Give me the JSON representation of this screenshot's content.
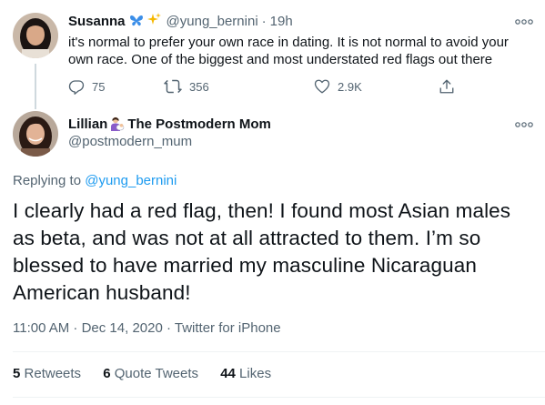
{
  "parent_tweet": {
    "author_name": "Susanna",
    "name_emojis": [
      "butterfly",
      "sparkles"
    ],
    "handle": "@yung_bernini",
    "separator": "·",
    "time": "19h",
    "text": "it's normal to prefer your own race in dating. It is not normal to avoid your own race. One of the biggest and most understated red flags out there",
    "actions": {
      "replies": "75",
      "retweets": "356",
      "likes": "2.9K"
    }
  },
  "main_tweet": {
    "author_name": "Lillian",
    "name_emoji": "woman-feeding-baby",
    "name_suffix": "The Postmodern Mom",
    "handle": "@postmodern_mum",
    "replying_prefix": "Replying to",
    "replying_to": "@yung_bernini",
    "text": "I clearly had a red flag, then! I found most Asian males as beta, and was not at all attracted to them. I’m so blessed to have married my masculine Nicaraguan American husband!",
    "timestamp": "11:00 AM · Dec 14, 2020 · Twitter for iPhone",
    "stats": {
      "retweets_count": "5",
      "retweets_label": "Retweets",
      "quotes_count": "6",
      "quotes_label": "Quote Tweets",
      "likes_count": "44",
      "likes_label": "Likes"
    }
  },
  "colors": {
    "text": "#0f1419",
    "secondary": "#536471",
    "link": "#1d9bf0",
    "divider": "#eff3f4"
  }
}
